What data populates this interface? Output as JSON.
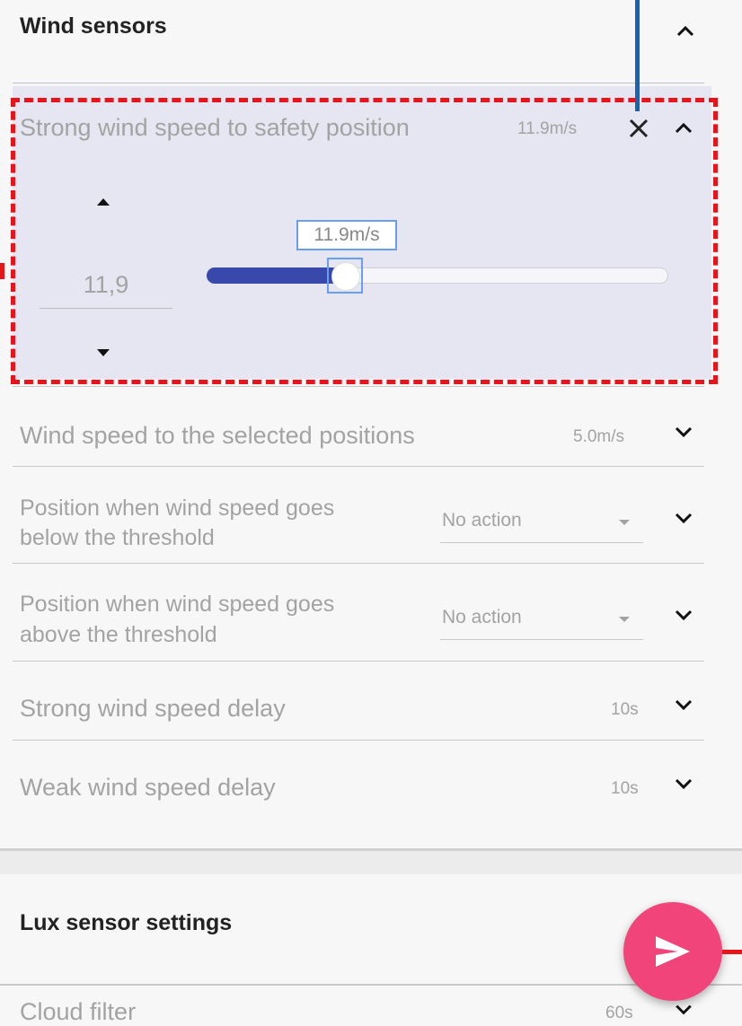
{
  "wind_sensors": {
    "title": "Wind sensors",
    "strong_wind": {
      "label": "Strong wind speed to safety position",
      "value": "11.9m/s",
      "input_value": "11,9",
      "slider_tooltip": "11.9m/s",
      "slider_fraction": 0.29
    },
    "rows": [
      {
        "label": "Wind speed to the selected positions",
        "value": "5.0m/s"
      },
      {
        "label": "Position when wind speed goes",
        "label2": "below the threshold",
        "select": "No action"
      },
      {
        "label": "Position when wind speed goes",
        "label2": "above the threshold",
        "select": "No action"
      },
      {
        "label": "Strong wind speed delay",
        "value": "10s"
      },
      {
        "label": "Weak wind speed delay",
        "value": "10s"
      }
    ]
  },
  "lux_sensor": {
    "title": "Lux sensor settings",
    "rows": [
      {
        "label": "Cloud filter",
        "value": "60s"
      }
    ]
  },
  "colors": {
    "highlight_bg": "#e6e6f2",
    "annotation_red": "#e8141c",
    "annotation_blue": "#1565b0",
    "slider_fill": "#3949ab",
    "fab": "#f0447a"
  }
}
